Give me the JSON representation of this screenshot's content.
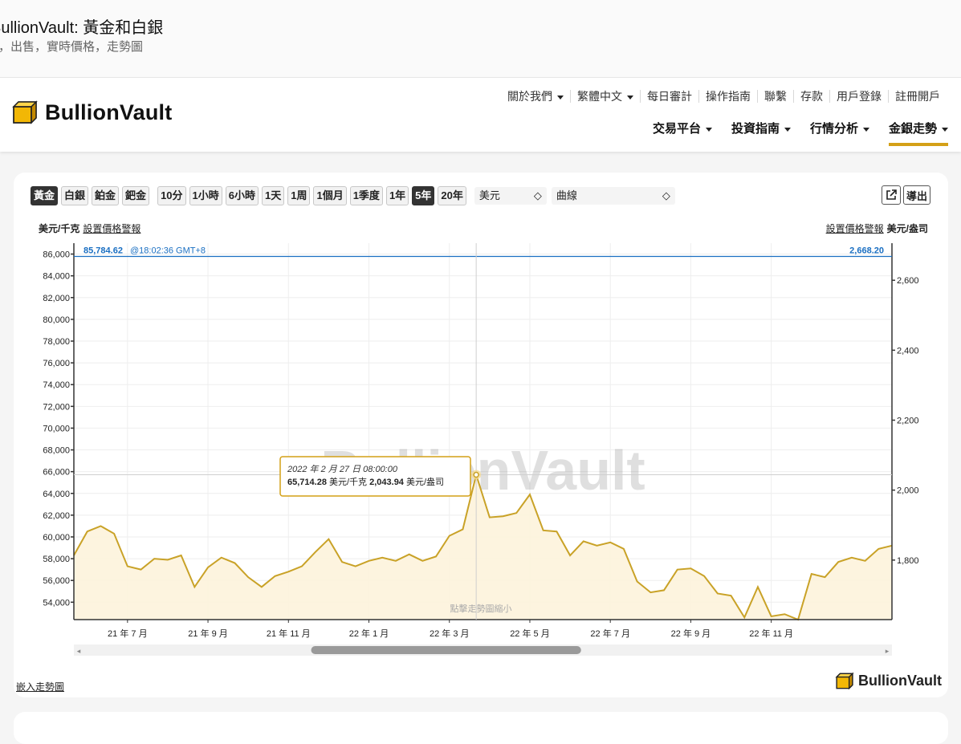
{
  "page": {
    "title": "BullionVault: 黃金和白銀",
    "subtitle": "，出售，實時價格，走勢圖"
  },
  "header": {
    "logo": "BullionVault",
    "util_nav": [
      "關於我們",
      "繁體中文",
      "每日審計",
      "操作指南",
      "聯繫",
      "存款",
      "用戶登錄",
      "註冊開戶"
    ],
    "util_dropdown": [
      true,
      true,
      false,
      false,
      false,
      false,
      false,
      false
    ],
    "main_nav": [
      "交易平台",
      "投資指南",
      "行情分析",
      "金銀走勢"
    ],
    "main_active": "金銀走勢"
  },
  "toolbar": {
    "metals": [
      "黃金",
      "白銀",
      "鉑金",
      "鈀金"
    ],
    "selected_metal": "黃金",
    "ranges": [
      "10分",
      "1小時",
      "6小時",
      "1天",
      "1周",
      "1個月",
      "1季度",
      "1年",
      "5年",
      "20年"
    ],
    "selected_range": "5年",
    "currency": "美元",
    "chart_style": "曲線",
    "export": "導出"
  },
  "labels": {
    "left_unit": "美元/千克",
    "alert": "設置價格警報",
    "right_unit": "美元/盎司",
    "current_left": "85,784.62",
    "current_time": "@18:02:36 GMT+8",
    "current_right": "2,668.20",
    "watermark": "BullionVault",
    "zoom_hint": "點擊走勢圖縮小",
    "tooltip_date": "2022 年 2 月 27 日 08:00:00",
    "tooltip_kg": "65,714.28",
    "tooltip_kg_unit": "美元/千克",
    "tooltip_oz": "2,043.94",
    "tooltip_oz_unit": "美元/盎司",
    "embed": "嵌入走勢圖",
    "footer_logo": "BullionVault"
  },
  "colors": {
    "accent": "#d4a017",
    "line": "#c9a227",
    "fill": "#fdf3dc",
    "current": "#1a6fc2"
  },
  "chart_data": {
    "type": "area",
    "x": [
      "2021-05",
      "2021-05",
      "2021-06",
      "2021-06",
      "2021-06",
      "2021-07",
      "2021-07",
      "2021-07",
      "2021-08",
      "2021-08",
      "2021-08",
      "2021-09",
      "2021-09",
      "2021-09",
      "2021-10",
      "2021-10",
      "2021-10",
      "2021-11",
      "2021-11",
      "2021-11",
      "2021-12",
      "2021-12",
      "2021-12",
      "2022-01",
      "2022-01",
      "2022-01",
      "2022-02",
      "2022-02",
      "2022-02",
      "2022-03",
      "2022-03",
      "2022-03",
      "2022-04",
      "2022-04",
      "2022-04",
      "2022-05",
      "2022-05",
      "2022-05",
      "2022-06",
      "2022-06",
      "2022-06",
      "2022-07",
      "2022-07",
      "2022-07",
      "2022-08",
      "2022-08",
      "2022-08",
      "2022-09",
      "2022-09",
      "2022-09",
      "2022-10",
      "2022-10",
      "2022-10",
      "2022-11",
      "2022-11",
      "2022-11",
      "2022-12",
      "2022-12",
      "2022-12",
      "2023-01",
      "2023-01",
      "2023-01"
    ],
    "y_kg": [
      58300,
      60500,
      61000,
      60300,
      57300,
      57000,
      58000,
      57900,
      58300,
      55400,
      57200,
      58100,
      57600,
      56300,
      55400,
      56400,
      56800,
      57300,
      58600,
      59800,
      57700,
      57300,
      57800,
      58100,
      57800,
      58400,
      57800,
      58200,
      60100,
      60700,
      65714,
      61800,
      61900,
      62200,
      63900,
      60600,
      60500,
      58300,
      59600,
      59200,
      59500,
      58900,
      55900,
      54900,
      55100,
      57000,
      57100,
      56400,
      54800,
      54600,
      52600,
      55400,
      52700,
      52900,
      52400,
      56600,
      56300,
      57700,
      58100,
      57800,
      58900,
      59200
    ],
    "y_range_kg": [
      52400,
      87000
    ],
    "left_ticks": [
      54000,
      56000,
      58000,
      60000,
      62000,
      64000,
      66000,
      68000,
      70000,
      72000,
      74000,
      76000,
      78000,
      80000,
      82000,
      84000,
      86000
    ],
    "right_ticks": [
      1800,
      2000,
      2200,
      2400,
      2600
    ],
    "x_ticks": [
      "21 年 7 月",
      "21 年 9 月",
      "21 年 11 月",
      "22 年 1 月",
      "22 年 3 月",
      "22 年 5 月",
      "22 年 7 月",
      "22 年 9 月",
      "22 年 11 月"
    ],
    "current_kg": 85784.62,
    "current_oz": 2668.2,
    "highlight_index": 30,
    "scroll_window": [
      0.29,
      0.62
    ]
  }
}
